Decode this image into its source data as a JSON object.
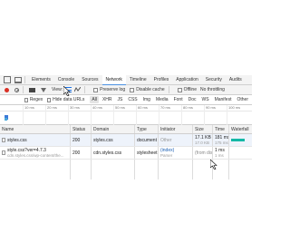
{
  "devtools": {
    "tabs": [
      "Elements",
      "Console",
      "Sources",
      "Network",
      "Timeline",
      "Profiles",
      "Application",
      "Security",
      "Audits"
    ],
    "active_tab": "Network",
    "toolbar": {
      "view_label": "View:",
      "preserve_log": "Preserve log",
      "disable_cache": "Disable cache",
      "offline": "Offline",
      "throttling": "No throttling"
    },
    "filter": {
      "placeholder": "Regex",
      "hide_data_urls": "Hide data URLs",
      "types": [
        "All",
        "XHR",
        "JS",
        "CSS",
        "Img",
        "Media",
        "Font",
        "Doc",
        "WS",
        "Manifest",
        "Other"
      ],
      "selected_type": "All"
    },
    "overview": {
      "ticks": [
        "10 ms",
        "20 ms",
        "30 ms",
        "40 ms",
        "50 ms",
        "60 ms",
        "70 ms",
        "80 ms",
        "90 ms",
        "100 ms",
        "110 ms"
      ]
    },
    "columns": [
      "Name",
      "Status",
      "Domain",
      "Type",
      "Initiator",
      "Size",
      "Time",
      "Waterfall"
    ],
    "rows": [
      {
        "name": "styles.css",
        "name_sub": "",
        "status": "200",
        "domain": "styles.css",
        "type": "document",
        "initiator": "Other",
        "initiator_sub": "",
        "size": "17.1 KB",
        "size_sub": "17.0 KB",
        "time": "181 ms",
        "time_sub": "175 ms",
        "waterfall": {
          "start": 0.1,
          "end": 0.75
        }
      },
      {
        "name": "style.css?ver=4.7.3",
        "name_sub": "cdn.styles.css/wp-content/the...",
        "status": "200",
        "domain": "cdn.styles.css",
        "type": "stylesheet",
        "initiator": "(index)",
        "initiator_sub": "Parser",
        "size": "(from dis...",
        "size_sub": "",
        "time": "1 ms",
        "time_sub": "1 ms",
        "waterfall": null
      }
    ]
  }
}
